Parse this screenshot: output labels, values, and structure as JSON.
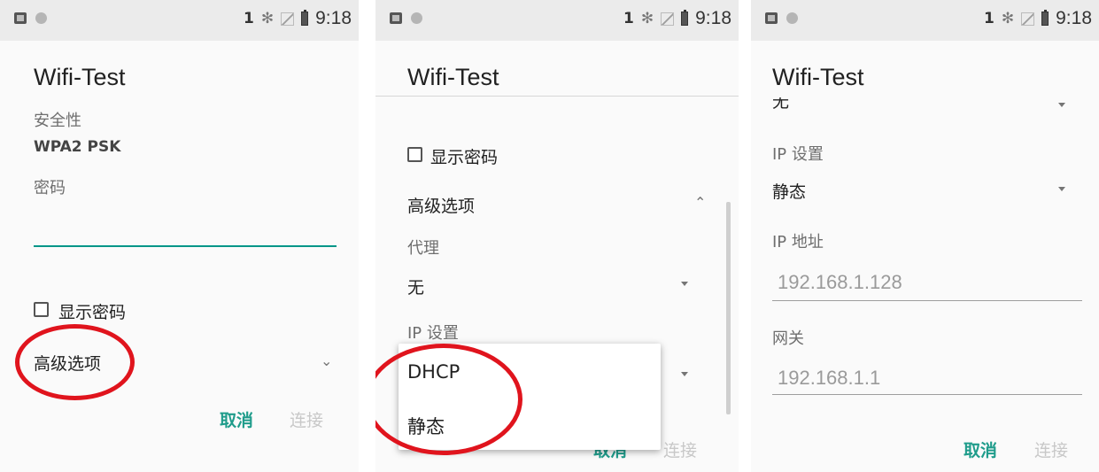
{
  "status_bar": {
    "sim": "1",
    "bluetooth": "✻",
    "time": "9:18"
  },
  "dialog_title": "Wifi-Test",
  "screen1": {
    "security_label": "安全性",
    "security_value": "WPA2 PSK",
    "password_label": "密码",
    "show_password": "显示密码",
    "advanced_options": "高级选项",
    "cancel": "取消",
    "connect": "连接"
  },
  "screen2": {
    "show_password": "显示密码",
    "advanced_options": "高级选项",
    "proxy_label": "代理",
    "proxy_value": "无",
    "ip_settings_label": "IP 设置",
    "dropdown_options": [
      "DHCP",
      "静态"
    ],
    "cancel_partial": "取消",
    "connect": "连接"
  },
  "screen3": {
    "proxy_value": "无",
    "ip_settings_label": "IP 设置",
    "ip_settings_value": "静态",
    "ip_address_label": "IP 地址",
    "ip_address_hint": "192.168.1.128",
    "gateway_label": "网关",
    "gateway_hint": "192.168.1.1",
    "cancel": "取消",
    "connect": "连接"
  },
  "colors": {
    "accent": "#1f9c8b",
    "highlight_ring": "#e0141d"
  },
  "icons": [
    "photo-icon",
    "circle-icon",
    "bluetooth-icon",
    "wifi-off-icon",
    "battery-icon",
    "chevron-down-icon",
    "chevron-up-icon",
    "dropdown-arrow-icon"
  ]
}
